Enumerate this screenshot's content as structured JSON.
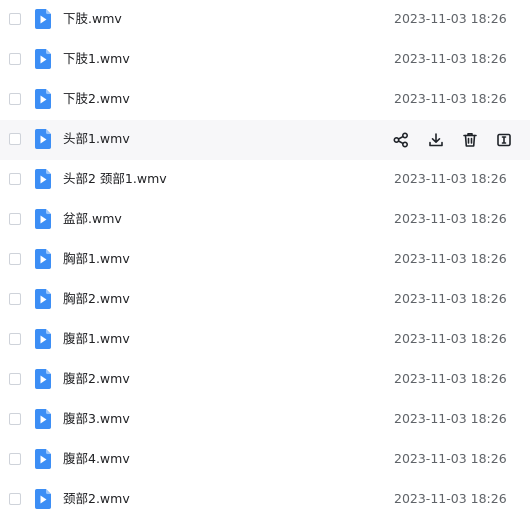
{
  "files": [
    {
      "name": "下肢.wmv",
      "time": "2023-11-03 18:26",
      "icon": "video-file-icon"
    },
    {
      "name": "下肢1.wmv",
      "time": "2023-11-03 18:26",
      "icon": "video-file-icon"
    },
    {
      "name": "下肢2.wmv",
      "time": "2023-11-03 18:26",
      "icon": "video-file-icon"
    },
    {
      "name": "头部1.wmv",
      "time": "2023-11-03 18:26",
      "icon": "video-file-icon",
      "hovered": true
    },
    {
      "name": "头部2 颈部1.wmv",
      "time": "2023-11-03 18:26",
      "icon": "video-file-icon"
    },
    {
      "name": "盆部.wmv",
      "time": "2023-11-03 18:26",
      "icon": "video-file-icon"
    },
    {
      "name": "胸部1.wmv",
      "time": "2023-11-03 18:26",
      "icon": "video-file-icon"
    },
    {
      "name": "胸部2.wmv",
      "time": "2023-11-03 18:26",
      "icon": "video-file-icon"
    },
    {
      "name": "腹部1.wmv",
      "time": "2023-11-03 18:26",
      "icon": "video-file-icon"
    },
    {
      "name": "腹部2.wmv",
      "time": "2023-11-03 18:26",
      "icon": "video-file-icon"
    },
    {
      "name": "腹部3.wmv",
      "time": "2023-11-03 18:26",
      "icon": "video-file-icon"
    },
    {
      "name": "腹部4.wmv",
      "time": "2023-11-03 18:26",
      "icon": "video-file-icon"
    },
    {
      "name": "颈部2.wmv",
      "time": "2023-11-03 18:26",
      "icon": "video-file-icon"
    }
  ],
  "row_actions": [
    {
      "name": "share",
      "icon": "share-icon"
    },
    {
      "name": "download",
      "icon": "download-icon"
    },
    {
      "name": "delete",
      "icon": "trash-icon"
    },
    {
      "name": "rename",
      "icon": "rename-icon"
    }
  ],
  "colors": {
    "icon_blue": "#3c8ef5",
    "icon_fold": "#9cc6fb",
    "text_primary": "#202124",
    "text_secondary": "#5f6368",
    "hover_bg": "#f7f7f9",
    "checkbox_border": "#cfd3da",
    "action_icon": "#1f2329"
  }
}
